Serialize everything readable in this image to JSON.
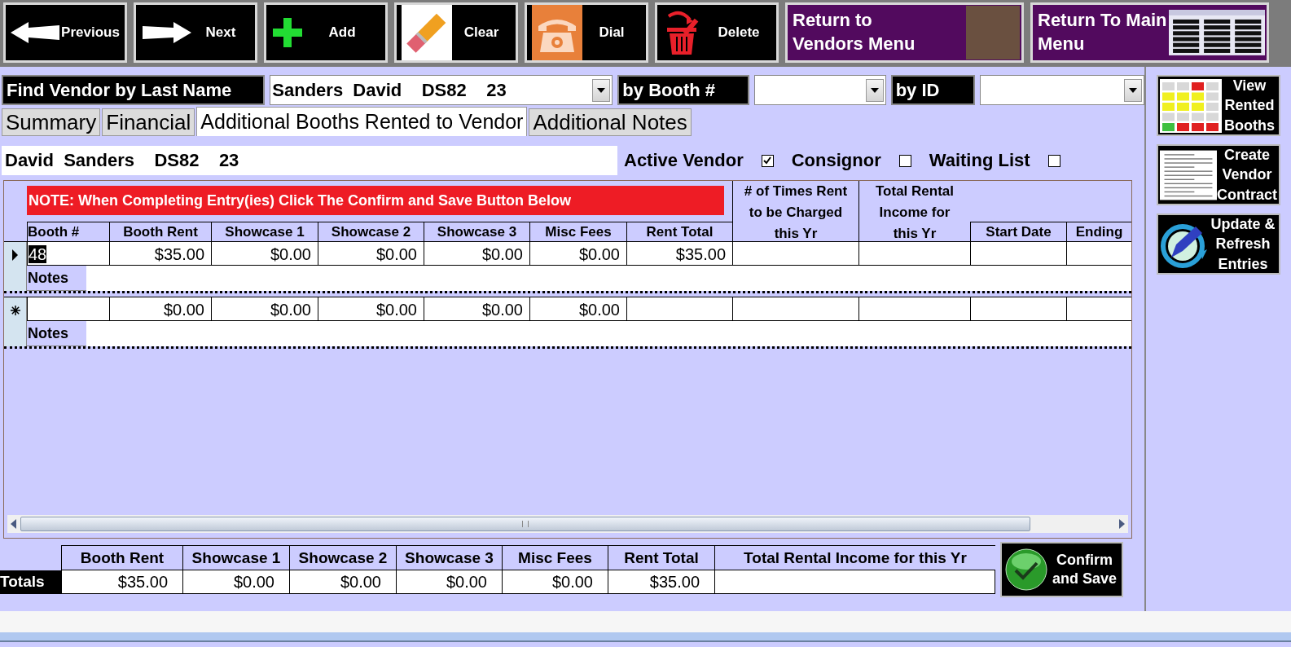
{
  "toolbar": [
    {
      "kind": "previous",
      "label": "Previous"
    },
    {
      "kind": "next",
      "label": "Next"
    },
    {
      "kind": "add",
      "label": "Add"
    },
    {
      "kind": "clear",
      "label": "Clear"
    },
    {
      "kind": "dial",
      "label": "Dial"
    },
    {
      "kind": "delete",
      "label": "Delete"
    }
  ],
  "menu_buttons": [
    {
      "kind": "vendors",
      "label": "Return to Vendors Menu"
    },
    {
      "kind": "main",
      "label": "Return To Main Menu"
    }
  ],
  "search": {
    "name_label": "Find Vendor by Last Name",
    "name_value": "Sanders  David    DS82    23",
    "booth_label": "by Booth #",
    "id_label": "by ID"
  },
  "tabs": [
    {
      "label": "Summary",
      "selected": false
    },
    {
      "label": "Financial",
      "selected": false
    },
    {
      "label": "Additional Booths Rented to Vendor",
      "selected": true
    },
    {
      "label": "Additional Notes",
      "selected": false
    }
  ],
  "vendor": {
    "name": "David  Sanders    DS82    23",
    "flags": [
      {
        "label": "Active Vendor",
        "checked": true
      },
      {
        "label": "Consignor",
        "checked": false
      },
      {
        "label": "Waiting List",
        "checked": false
      }
    ]
  },
  "grid": {
    "note": "NOTE: When Completing Entry(ies) Click The Confirm and Save Button Below",
    "columns": [
      "Booth #",
      "Booth Rent",
      "Showcase 1",
      "Showcase 2",
      "Showcase 3",
      "Misc Fees",
      "Rent Total",
      "# of Times Rent to be Charged this Yr",
      "Total Rental Income for this Yr",
      "Start Date",
      "Ending"
    ],
    "rows": [
      {
        "kind": "current",
        "booth_selected": true,
        "cells": [
          "48",
          "$35.00",
          "$0.00",
          "$0.00",
          "$0.00",
          "$0.00",
          "$35.00",
          null,
          null,
          null,
          null
        ],
        "notes_label": "Notes"
      },
      {
        "kind": "new",
        "cells": [
          null,
          "$0.00",
          "$0.00",
          "$0.00",
          "$0.00",
          "$0.00",
          null,
          null,
          null,
          null,
          null
        ],
        "notes_label": "Notes"
      }
    ]
  },
  "totals": {
    "label": "Totals",
    "columns": [
      "Booth Rent",
      "Showcase 1",
      "Showcase 2",
      "Showcase 3",
      "Misc Fees",
      "Rent Total",
      "Total Rental Income for this Yr"
    ],
    "values": [
      "$35.00",
      "$0.00",
      "$0.00",
      "$0.00",
      "$0.00",
      "$35.00"
    ]
  },
  "confirm_button": {
    "label": "Confirm and Save"
  },
  "side_buttons": [
    {
      "kind": "booths",
      "label": "View Rented Booths"
    },
    {
      "kind": "contract",
      "label": "Create Vendor Contract"
    },
    {
      "kind": "refresh",
      "label": "Update & Refresh Entries"
    }
  ]
}
